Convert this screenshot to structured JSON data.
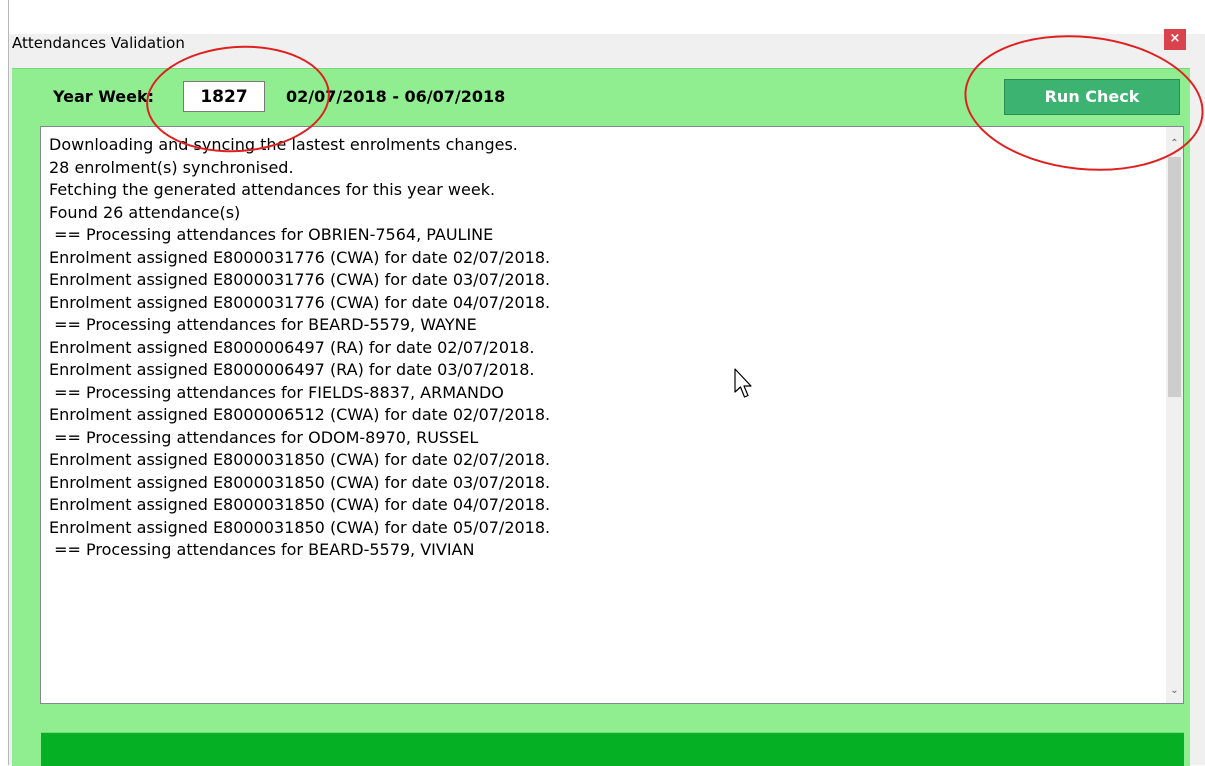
{
  "window": {
    "title": "Attendances Validation",
    "close_symbol": "×"
  },
  "header": {
    "year_week_label": "Year Week:",
    "year_week_value": "1827",
    "date_range": "02/07/2018 - 06/07/2018",
    "run_check_label": "Run Check"
  },
  "log": {
    "lines": [
      "Downloading and syncing the lastest enrolments changes.",
      "28 enrolment(s) synchronised.",
      "Fetching the generated attendances for this year week.",
      "Found 26 attendance(s)",
      " == Processing attendances for OBRIEN-7564, PAULINE",
      "Enrolment assigned E8000031776 (CWA) for date 02/07/2018.",
      "Enrolment assigned E8000031776 (CWA) for date 03/07/2018.",
      "Enrolment assigned E8000031776 (CWA) for date 04/07/2018.",
      " == Processing attendances for BEARD-5579, WAYNE",
      "Enrolment assigned E8000006497 (RA) for date 02/07/2018.",
      "Enrolment assigned E8000006497 (RA) for date 03/07/2018.",
      " == Processing attendances for FIELDS-8837, ARMANDO",
      "Enrolment assigned E8000006512 (CWA) for date 02/07/2018.",
      " == Processing attendances for ODOM-8970, RUSSEL",
      "Enrolment assigned E8000031850 (CWA) for date 02/07/2018.",
      "Enrolment assigned E8000031850 (CWA) for date 03/07/2018.",
      "Enrolment assigned E8000031850 (CWA) for date 04/07/2018.",
      "Enrolment assigned E8000031850 (CWA) for date 05/07/2018.",
      " == Processing attendances for BEARD-5579, VIVIAN"
    ]
  },
  "scrollbar": {
    "up_symbol": "⌃",
    "down_symbol": "⌄"
  },
  "colors": {
    "form_background": "#90ee90",
    "button_green": "#3cb371",
    "status_green": "#06b025",
    "annotation_red": "#e02020",
    "close_red": "#d9434e"
  }
}
